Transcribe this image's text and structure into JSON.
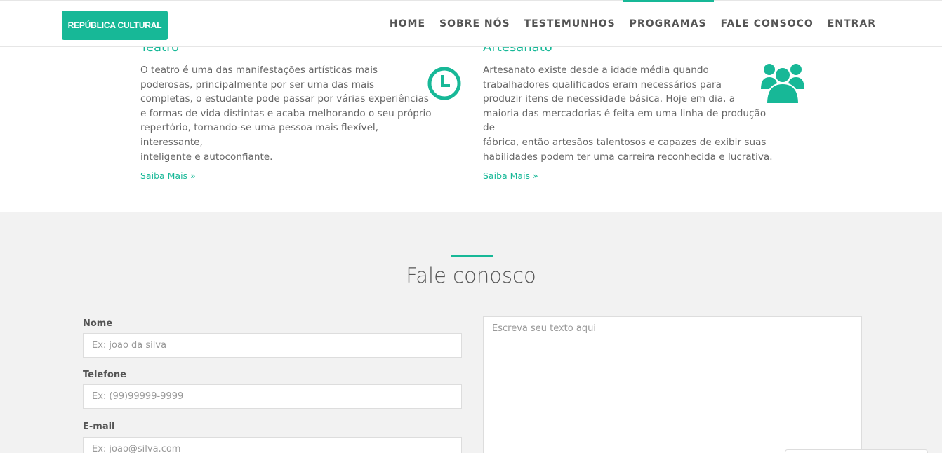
{
  "brand": {
    "label": "REPÚBLICA CULTURAL"
  },
  "nav": {
    "items": [
      {
        "label": "HOME"
      },
      {
        "label": "SOBRE NÓS"
      },
      {
        "label": "TESTEMUNHOS"
      },
      {
        "label": "PROGRAMAS",
        "active": true
      },
      {
        "label": "FALE CONSOCO"
      },
      {
        "label": "ENTRAR"
      }
    ]
  },
  "programs": [
    {
      "title": "Teatro",
      "lines": [
        "O teatro é uma das manifestações artísticas mais",
        "poderosas, principalmente por ser uma das mais",
        "completas, o estudante pode passar por várias experiências",
        "e formas de vida distintas e acaba melhorando o seu próprio",
        "repertório, tornando-se uma pessoa mais flexível, interessante,",
        "inteligente e autoconfiante."
      ],
      "link": "Saiba Mais »",
      "icon": "clock-icon"
    },
    {
      "title": "Artesanato",
      "lines": [
        "Artesanato existe desde a idade média quando",
        "trabalhadores qualificados eram necessários para",
        "produzir itens de necessidade básica. Hoje em dia, a",
        "maioria das mercadorias é feita em uma linha de produção de",
        "fábrica, então artesãos talentosos e capazes de exibir suas",
        "habilidades podem ter uma carreira reconhecida e lucrativa."
      ],
      "link": "Saiba Mais »",
      "icon": "users-icon"
    }
  ],
  "contact": {
    "title": "Fale conosco",
    "name_label": "Nome",
    "name_placeholder": "Ex: joao da silva",
    "phone_label": "Telefone",
    "phone_placeholder": "Ex: (99)99999-9999",
    "email_label": "E-mail",
    "email_placeholder": "Ex: joao@silva.com",
    "message_placeholder": "Escreva seu texto aqui"
  },
  "colors": {
    "accent": "#17b897",
    "section_bg": "#f2f2f2",
    "text": "#555555"
  }
}
